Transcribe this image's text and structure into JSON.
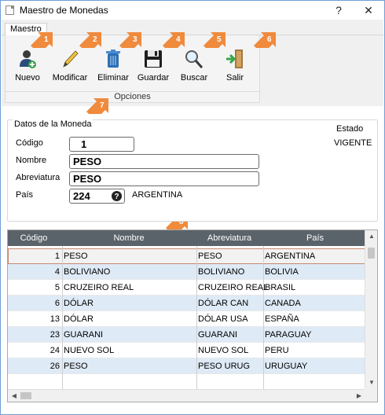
{
  "window": {
    "title": "Maestro de Monedas",
    "help": "?",
    "close": "✕"
  },
  "tabs": [
    {
      "label": "Maestro"
    }
  ],
  "toolbar": {
    "buttons": [
      {
        "label": "Nuevo",
        "icon": "new-user-icon"
      },
      {
        "label": "Modificar",
        "icon": "pencil-icon"
      },
      {
        "label": "Eliminar",
        "icon": "trash-icon"
      },
      {
        "label": "Guardar",
        "icon": "save-icon"
      },
      {
        "label": "Buscar",
        "icon": "search-icon"
      },
      {
        "label": "Salir",
        "icon": "exit-icon"
      }
    ],
    "group_label": "Opciones"
  },
  "callouts": [
    "1",
    "2",
    "3",
    "4",
    "5",
    "6",
    "7",
    "8"
  ],
  "callout_color": "#f08a3c",
  "form": {
    "title": "Datos de la Moneda",
    "estado_label": "Estado",
    "estado_value": "VIGENTE",
    "codigo_label": "Código",
    "codigo_value": "1",
    "nombre_label": "Nombre",
    "nombre_value": "PESO",
    "abreviatura_label": "Abreviatura",
    "abreviatura_value": "PESO",
    "pais_label": "País",
    "pais_code": "224",
    "pais_name": "ARGENTINA"
  },
  "grid": {
    "headers": [
      "Código",
      "Nombre",
      "Abreviatura",
      "País"
    ],
    "header_color": "#5b636a",
    "alt_row_color": "#deeaf6",
    "rows": [
      {
        "code": "1",
        "name": "PESO",
        "abbr": "PESO",
        "country": "ARGENTINA"
      },
      {
        "code": "4",
        "name": "BOLIVIANO",
        "abbr": "BOLIVIANO",
        "country": "BOLIVIA"
      },
      {
        "code": "5",
        "name": "CRUZEIRO REAL",
        "abbr": "CRUZEIRO REAL",
        "country": "BRASIL"
      },
      {
        "code": "6",
        "name": "DÓLAR",
        "abbr": "DÓLAR CAN",
        "country": "CANADA"
      },
      {
        "code": "13",
        "name": "DÓLAR",
        "abbr": "DÓLAR USA",
        "country": "ESPAÑA"
      },
      {
        "code": "23",
        "name": "GUARANI",
        "abbr": "GUARANI",
        "country": "PARAGUAY"
      },
      {
        "code": "24",
        "name": "NUEVO SOL",
        "abbr": "NUEVO SOL",
        "country": "PERU"
      },
      {
        "code": "26",
        "name": "PESO",
        "abbr": "PESO URUG",
        "country": "URUGUAY"
      }
    ]
  }
}
